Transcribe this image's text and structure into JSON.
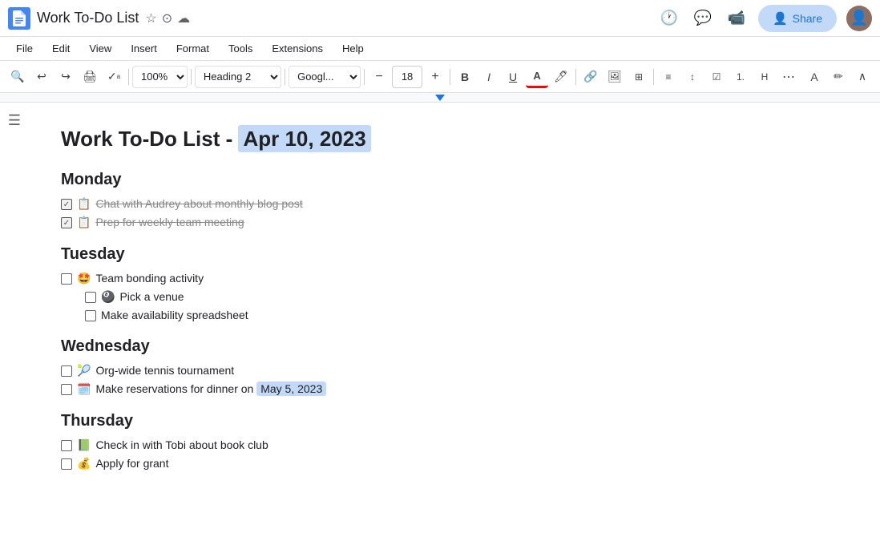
{
  "titleBar": {
    "docTitle": "Work To-Do List",
    "shareLabel": "Share"
  },
  "menuBar": {
    "items": [
      "File",
      "Edit",
      "View",
      "Insert",
      "Format",
      "Tools",
      "Extensions",
      "Help"
    ]
  },
  "toolbar": {
    "zoom": "100%",
    "style": "Heading 2",
    "font": "Googl...",
    "fontSize": "18",
    "boldLabel": "B",
    "italicLabel": "I",
    "underlineLabel": "U"
  },
  "document": {
    "title": "Work To-Do List - ",
    "titleDate": "Apr 10, 2023",
    "sections": [
      {
        "heading": "Monday",
        "tasks": [
          {
            "checked": true,
            "strikethrough": true,
            "emoji": "📋",
            "text": "Chat with Audrey about monthly blog post",
            "sub": false
          },
          {
            "checked": true,
            "strikethrough": true,
            "emoji": "📋",
            "text": "Prep for weekly team meeting",
            "sub": false
          }
        ]
      },
      {
        "heading": "Tuesday",
        "tasks": [
          {
            "checked": false,
            "strikethrough": false,
            "emoji": "🤩",
            "text": "Team bonding activity",
            "sub": false
          },
          {
            "checked": false,
            "strikethrough": false,
            "emoji": "🎱",
            "text": "Pick a venue",
            "sub": true
          },
          {
            "checked": false,
            "strikethrough": false,
            "emoji": "",
            "text": "Make availability spreadsheet",
            "sub": true
          }
        ]
      },
      {
        "heading": "Wednesday",
        "tasks": [
          {
            "checked": false,
            "strikethrough": false,
            "emoji": "🎾",
            "text": "Org-wide tennis tournament",
            "sub": false
          },
          {
            "checked": false,
            "strikethrough": false,
            "emoji": "🗓️",
            "text": "Make reservations for dinner on ",
            "inlineDate": "May 5, 2023",
            "sub": false
          }
        ]
      },
      {
        "heading": "Thursday",
        "tasks": [
          {
            "checked": false,
            "strikethrough": false,
            "emoji": "📗",
            "text": "Check in with Tobi about book club",
            "sub": false
          },
          {
            "checked": false,
            "strikethrough": false,
            "emoji": "💰",
            "text": "Apply for grant",
            "sub": false
          }
        ]
      }
    ]
  }
}
